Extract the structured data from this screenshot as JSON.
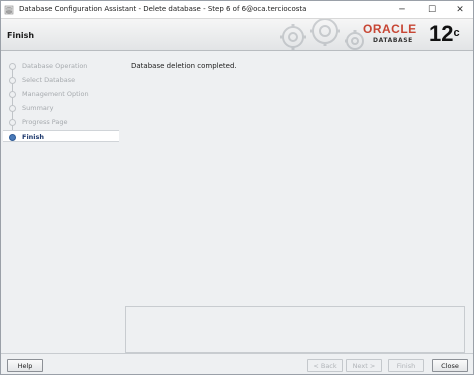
{
  "window": {
    "title": "Database Configuration Assistant - Delete database - Step 6 of 6@oca.terciocosta",
    "controls": {
      "minimize": "─",
      "maximize": "☐",
      "close": "✕"
    }
  },
  "header": {
    "page_title": "Finish",
    "logo_oracle": "ORACLE",
    "logo_database": "DATABASE",
    "version": "12",
    "version_sup": "c"
  },
  "nav": {
    "items": [
      {
        "label": "Database Operation",
        "state": "done"
      },
      {
        "label": "Select Database",
        "state": "done"
      },
      {
        "label": "Management Option",
        "state": "done"
      },
      {
        "label": "Summary",
        "state": "done"
      },
      {
        "label": "Progress Page",
        "state": "done"
      },
      {
        "label": "Finish",
        "state": "active"
      }
    ]
  },
  "main": {
    "message": "Database deletion completed."
  },
  "footer": {
    "help": "Help",
    "back": "< Back",
    "next": "Next >",
    "finish": "Finish",
    "close": "Close"
  },
  "colors": {
    "oracle_red": "#c74634",
    "active_step": "#1f3a6e"
  },
  "icons": {
    "app": "dbca-app-icon",
    "banner": "gears-graphic"
  }
}
